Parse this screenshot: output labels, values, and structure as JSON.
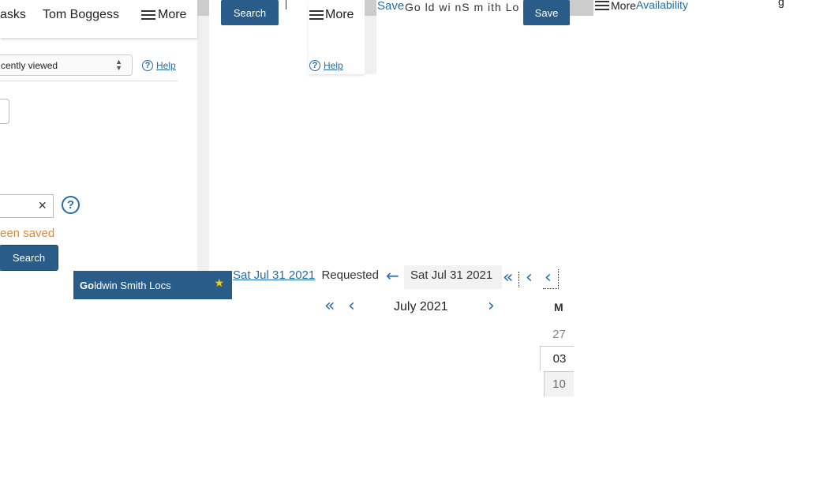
{
  "panel_a": {
    "nav": {
      "tasks": "asks",
      "user": "Tom Boggess",
      "more": "More"
    },
    "recent_select": "cently viewed",
    "help": "Help",
    "saved_msg": "een saved",
    "search": "Search",
    "clear_glyph": "×",
    "help_glyph": "?"
  },
  "panel_b": {
    "search": "Search"
  },
  "panel_c": {
    "more": "More",
    "help": "Help"
  },
  "panel_d": {
    "save_link": "Save",
    "garbled_title": "Go ld wi nS m ith Lo c s",
    "save_button": "Save"
  },
  "panel_e": {
    "more": "More",
    "availability": "Availability",
    "tail": "g"
  },
  "favorite": {
    "label_bold": "Go",
    "label_rest": "ldwin Smith Locs",
    "star": "★"
  },
  "date_bar": {
    "date_link": "Sat Jul 31 2021",
    "requested": "Requested",
    "back_arrow": "←",
    "date_text": "Sat Jul 31 2021",
    "dbl_prev": "«",
    "prev": "‹"
  },
  "calendar": {
    "month": "July 2021",
    "dbl_prev": "«",
    "prev": "‹",
    "next": "›",
    "day_header": "M",
    "days": [
      "27",
      "03",
      "10"
    ]
  },
  "colors": {
    "accent": "#2a5c8a",
    "warning": "#e8872b",
    "link": "#1f6ea8"
  }
}
